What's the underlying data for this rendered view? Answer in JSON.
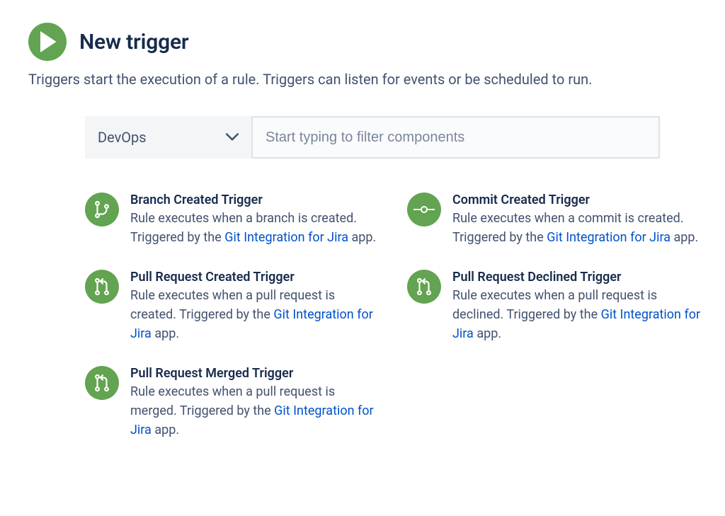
{
  "header": {
    "title": "New trigger",
    "description": "Triggers start the execution of a rule. Triggers can listen for events or be scheduled to run."
  },
  "filter": {
    "dropdown_label": "DevOps",
    "input_placeholder": "Start typing to filter components"
  },
  "triggers": [
    {
      "icon": "branch",
      "title": "Branch Created Trigger",
      "desc_before": "Rule executes when a branch is created. Triggered by the ",
      "link_text": "Git Integration for Jira",
      "desc_after": " app."
    },
    {
      "icon": "commit",
      "title": "Commit Created Trigger",
      "desc_before": "Rule executes when a commit is created. Triggered by the ",
      "link_text": "Git Integration for Jira",
      "desc_after": " app."
    },
    {
      "icon": "pull",
      "title": "Pull Request Created Trigger",
      "desc_before": "Rule executes when a pull request is created. Triggered by the ",
      "link_text": "Git Integration for Jira",
      "desc_after": " app."
    },
    {
      "icon": "pull",
      "title": "Pull Request Declined Trigger",
      "desc_before": "Rule executes when a pull request is declined. Triggered by the ",
      "link_text": "Git Integration for Jira",
      "desc_after": " app."
    },
    {
      "icon": "pull",
      "title": "Pull Request Merged Trigger",
      "desc_before": "Rule executes when a pull request is merged. Triggered by the ",
      "link_text": "Git Integration for Jira",
      "desc_after": " app."
    }
  ]
}
